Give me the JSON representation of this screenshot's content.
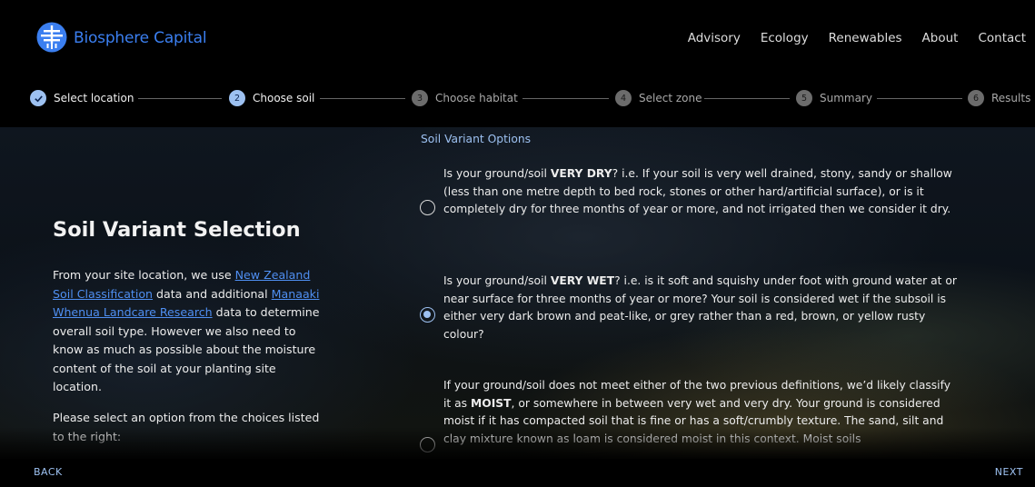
{
  "brand": {
    "name": "Biosphere Capital"
  },
  "nav": [
    "Advisory",
    "Ecology",
    "Renewables",
    "About",
    "Contact"
  ],
  "stepper": [
    {
      "num": "",
      "label": "Select location",
      "state": "done"
    },
    {
      "num": "2",
      "label": "Choose soil",
      "state": "active"
    },
    {
      "num": "3",
      "label": "Choose habitat",
      "state": "todo"
    },
    {
      "num": "4",
      "label": "Select zone",
      "state": "todo"
    },
    {
      "num": "5",
      "label": "Summary",
      "state": "todo"
    },
    {
      "num": "6",
      "label": "Results",
      "state": "todo"
    }
  ],
  "left": {
    "title": "Soil Variant Selection",
    "p1_a": "From your site location, we use ",
    "link1": "New Zealand Soil Classification",
    "p1_b": " data and additional ",
    "link2": "Manaaki Whenua Landcare Research",
    "p1_c": " data to determine overall soil type. However we also need to know as much as possible about the moisture content of the soil at your planting site location.",
    "p2": "Please select an option from the choices listed to the right:"
  },
  "options": {
    "title": "Soil Variant Options",
    "items": [
      {
        "pre": "Is your ground/soil ",
        "bold": "VERY DRY",
        "post": "? i.e. If your soil is very well drained, stony, sandy or shallow (less than one metre depth to bed rock, stones or other hard/artificial surface), or is it completely dry for three months of year or more, and not irrigated then we consider it dry.",
        "checked": false
      },
      {
        "pre": "Is your ground/soil ",
        "bold": "VERY WET",
        "post": "? i.e. is it soft and squishy under foot with ground water at or near surface for three months of year or more? Your soil is considered wet if the subsoil is either very dark brown and peat-like, or grey rather than a red, brown, or yellow rusty colour?",
        "checked": true
      },
      {
        "pre": "If your ground/soil does not meet either of the two previous definitions, we’d likely classify it as ",
        "bold": "MOIST",
        "post": ", or somewhere in between very wet and very dry. Your ground is considered moist if it has compacted soil that is fine or has a soft/crumbly texture. The sand, silt and clay mixture known as loam is considered moist in this context. Moist soils",
        "checked": false
      }
    ]
  },
  "footer": {
    "back": "BACK",
    "next": "NEXT"
  },
  "colors": {
    "accent": "#9dc1f1",
    "brand": "#3b7ff0",
    "link": "#4f8ff2"
  }
}
